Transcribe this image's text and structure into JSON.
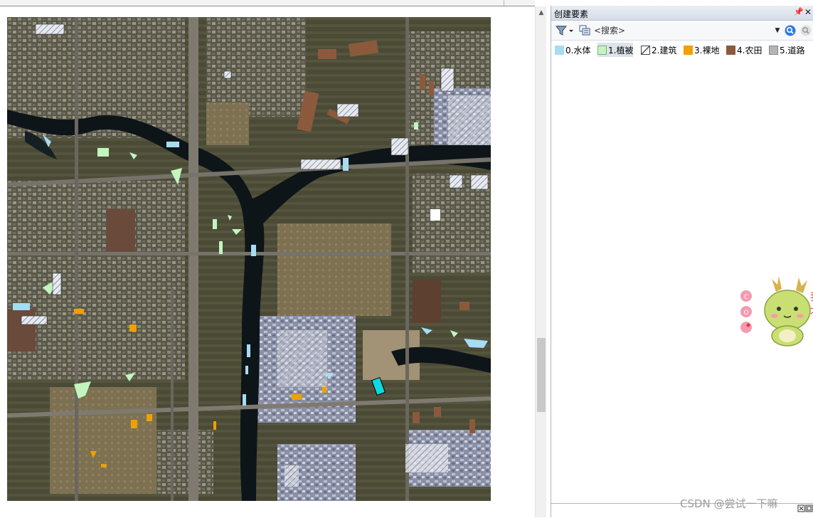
{
  "pane": {
    "title": "创建要素",
    "search_placeholder": "<搜索>",
    "templates": [
      {
        "label": "0.水体",
        "color": "#a6dcf2",
        "hatched": false,
        "selected": false
      },
      {
        "label": "1.植被",
        "color": "#c3f5bf",
        "hatched": false,
        "selected": true
      },
      {
        "label": "2.建筑",
        "color": "#ffffff",
        "hatched": true,
        "selected": false
      },
      {
        "label": "3.裸地",
        "color": "#f0a000",
        "hatched": false,
        "selected": false
      },
      {
        "label": "4.农田",
        "color": "#8b5a3c",
        "hatched": false,
        "selected": false
      },
      {
        "label": "5.道路",
        "color": "#b4b4b4",
        "hatched": false,
        "selected": false
      }
    ]
  },
  "icons": {
    "filter": "filter-dropdown-icon",
    "organize": "organize-templates-icon",
    "search": "magnifier-icon",
    "clear": "clear-search-icon",
    "pin": "pin-icon",
    "close": "close-icon"
  },
  "watermark": "CSDN @尝试一下嘛"
}
